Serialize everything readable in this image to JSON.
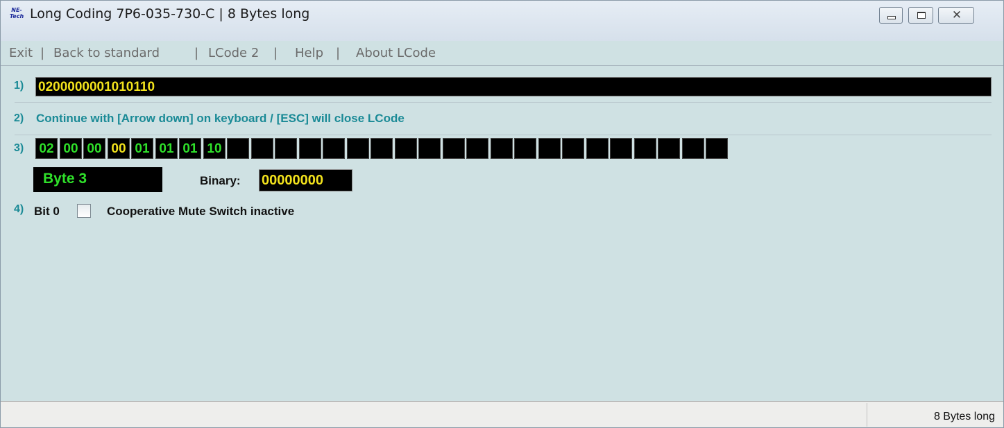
{
  "window": {
    "title": "Long Coding  7P6-035-730-C | 8 Bytes long",
    "icon_text_top": "NE-",
    "icon_text_bottom": "Tech",
    "close_glyph": "✕"
  },
  "menu": {
    "items": [
      {
        "label": "Exit"
      },
      {
        "label": "Back to standard"
      },
      {
        "label": "LCode 2"
      },
      {
        "label": "Help"
      },
      {
        "label": "About LCode"
      }
    ],
    "separator": "|"
  },
  "step1": {
    "num": "1)",
    "coding_value": "0200000001010110"
  },
  "step2": {
    "num": "2)",
    "instruction": "Continue with [Arrow down] on keyboard / [ESC] will close LCode"
  },
  "step3": {
    "num": "3)",
    "bytes": [
      {
        "value": "02",
        "color": "green"
      },
      {
        "value": "00",
        "color": "green"
      },
      {
        "value": "00",
        "color": "green"
      },
      {
        "value": "00",
        "color": "yellow"
      },
      {
        "value": "01",
        "color": "green"
      },
      {
        "value": "01",
        "color": "green"
      },
      {
        "value": "01",
        "color": "green"
      },
      {
        "value": "10",
        "color": "green"
      },
      {
        "value": ""
      },
      {
        "value": ""
      },
      {
        "value": ""
      },
      {
        "value": ""
      },
      {
        "value": ""
      },
      {
        "value": ""
      },
      {
        "value": ""
      },
      {
        "value": ""
      },
      {
        "value": ""
      },
      {
        "value": ""
      },
      {
        "value": ""
      },
      {
        "value": ""
      },
      {
        "value": ""
      },
      {
        "value": ""
      },
      {
        "value": ""
      },
      {
        "value": ""
      },
      {
        "value": ""
      },
      {
        "value": ""
      },
      {
        "value": ""
      },
      {
        "value": ""
      },
      {
        "value": ""
      }
    ],
    "selected_byte_label": "Byte 3",
    "binary_label": "Binary:",
    "binary_value": "00000000"
  },
  "step4": {
    "num": "4)",
    "bit_label": "Bit 0",
    "bit_checked": false,
    "bit_description": "Cooperative Mute Switch inactive"
  },
  "statusbar": {
    "text": "8 Bytes long"
  },
  "colors": {
    "green": "#2fe02a",
    "yellow": "#f2e21c",
    "label_teal": "#1a8a96",
    "background": "#cfe1e3"
  }
}
